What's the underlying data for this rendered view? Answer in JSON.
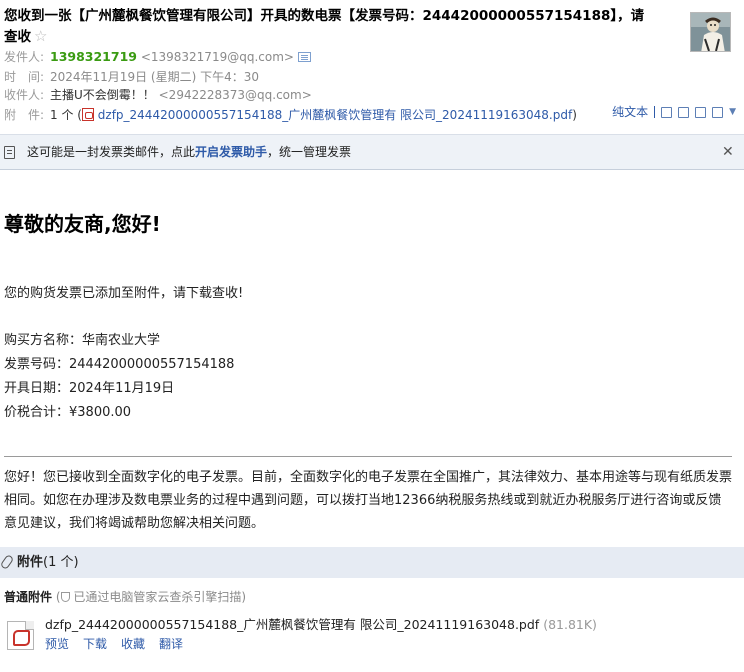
{
  "header": {
    "subject_line1": "您收到一张【广州麓枫餐饮管理有限公司】开具的数电票【发票号码：24442000000557154188】，请",
    "subject_line2": "查收",
    "sender_label": "发件人:",
    "sender_name": "1398321719",
    "sender_email": "<1398321719@qq.com>",
    "time_label": "时　间:",
    "time_value": "2024年11月19日 (星期二) 下午4：30",
    "recipient_label": "收件人:",
    "recipient_name": "主播U不会倒霉！！",
    "recipient_email": "<2942228373@qq.com>",
    "attachment_label": "附　件:",
    "attachment_count": "1 个 (",
    "attachment_file": "dzfp_24442000000557154188_广州麓枫餐饮管理有 限公司_20241119163048.pdf",
    "attachment_close": ")",
    "plain_text": "纯文本"
  },
  "notice": {
    "text_before": "这可能是一封发票类邮件，点此",
    "link": "开启发票助手",
    "text_after": "，统一管理发票"
  },
  "body": {
    "greeting": "尊敬的友商,您好!",
    "intro": "您的购货发票已添加至附件，请下载查收!",
    "buyer": "购买方名称：华南农业大学",
    "invoice_no": "发票号码：24442000000557154188",
    "issue_date": "开具日期：2024年11月19日",
    "total": "价税合计：¥3800.00",
    "paragraph": "您好！您已接收到全面数字化的电子发票。目前，全面数字化的电子发票在全国推广，其法律效力、基本用途等与现有纸质发票相同。如您在办理涉及数电票业务的过程中遇到问题，可以拨打当地12366纳税服务热线或到就近办税服务厅进行咨询或反馈意见建议，我们将竭诚帮助您解决相关问题。"
  },
  "attachments": {
    "title": "附件",
    "count": "(1 个)",
    "section_label": "普通附件",
    "scan_text": "已通过电脑管家云查杀引擎扫描",
    "file_name": "dzfp_24442000000557154188_广州麓枫餐饮管理有 限公司_20241119163048.pdf",
    "file_size": "(81.81K)",
    "actions": [
      "预览",
      "下载",
      "收藏",
      "翻译"
    ]
  }
}
